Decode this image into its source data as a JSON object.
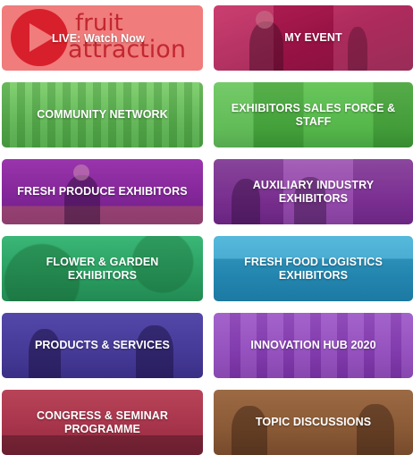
{
  "tiles": [
    {
      "label": "LIVE: Watch Now",
      "logo_word_1": "fruit",
      "logo_word_2": "attraction",
      "color": "#f07c7c"
    },
    {
      "label": "MY EVENT",
      "color": "#b0174f"
    },
    {
      "label": "COMMUNITY NETWORK",
      "color": "#6cc35a"
    },
    {
      "label": "EXHIBITORS SALES FORCE & STAFF",
      "color": "#52b946"
    },
    {
      "label": "FRESH PRODUCE EXHIBITORS",
      "color": "#8a2aa0"
    },
    {
      "label": "AUXILIARY INDUSTRY EXHIBITORS",
      "color": "#8e3aa4"
    },
    {
      "label": "FLOWER & GARDEN EXHIBITORS",
      "color": "#2fa769"
    },
    {
      "label": "FRESH FOOD LOGISTICS EXHIBITORS",
      "color": "#2f9fc9"
    },
    {
      "label": "PRODUCTS & SERVICES",
      "color": "#4a3f9a"
    },
    {
      "label": "INNOVATION HUB 2020",
      "color": "#8a3fb8"
    },
    {
      "label": "CONGRESS & SEMINAR PROGRAMME",
      "color": "#a5334a"
    },
    {
      "label": "TOPIC DISCUSSIONS",
      "color": "#8a5a36"
    }
  ]
}
